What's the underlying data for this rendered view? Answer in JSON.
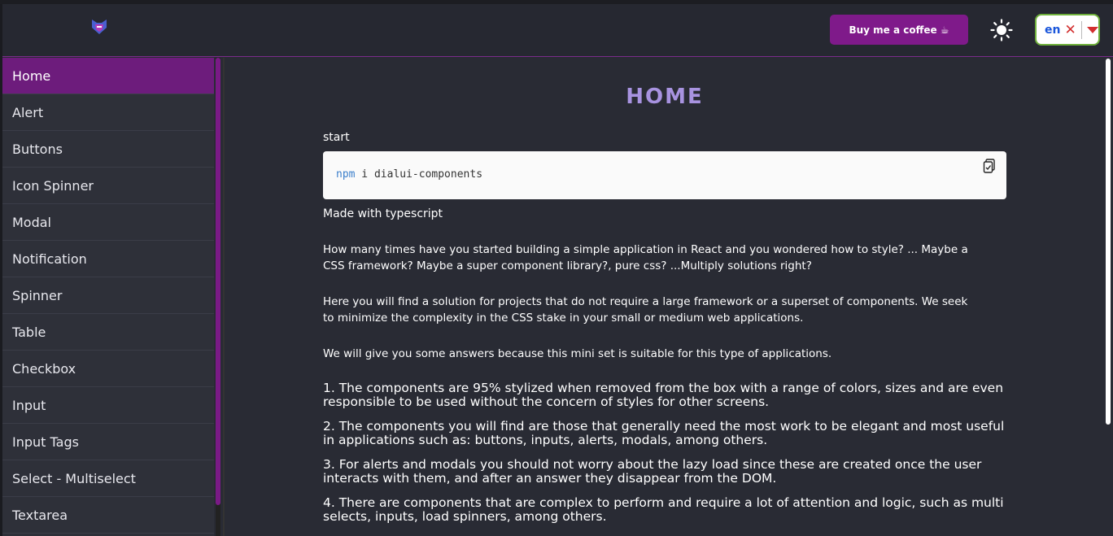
{
  "header": {
    "coffee_button": "Buy me a coffee ☕",
    "language": {
      "value": "en"
    }
  },
  "sidebar": {
    "items": [
      {
        "label": "Home",
        "active": true
      },
      {
        "label": "Alert"
      },
      {
        "label": "Buttons"
      },
      {
        "label": "Icon Spinner"
      },
      {
        "label": "Modal"
      },
      {
        "label": "Notification"
      },
      {
        "label": "Spinner"
      },
      {
        "label": "Table"
      },
      {
        "label": "Checkbox"
      },
      {
        "label": "Input"
      },
      {
        "label": "Input Tags"
      },
      {
        "label": "Select - Multiselect"
      },
      {
        "label": "Textarea"
      }
    ]
  },
  "main": {
    "title": "HOME",
    "start_label": "start",
    "code": {
      "keyword": "npm",
      "rest": " i dialui-components"
    },
    "made_with": "Made with typescript",
    "paragraphs": [
      "How many times have you started building a simple application in React and you wondered how to style? ... Maybe a CSS framework? Maybe a super component library?, pure css? ...Multiply solutions right?",
      "Here you will find a solution for projects that do not require a large framework or a superset of components. We seek to minimize the complexity in the CSS stake in your small or medium web applications.",
      "We will give you some answers because this mini set is suitable for this type of applications."
    ],
    "list": [
      "1. The components are 95% stylized when removed from the box with a range of colors, sizes and are even responsible to be used without the concern of styles for other screens.",
      "2. The components you will find are those that generally need the most work to be elegant and most useful in applications such as: buttons, inputs, alerts, modals, among others.",
      "3. For alerts and modals you should not worry about the lazy load since these are created once the user interacts with them, and after an answer they disappear from the DOM.",
      "4. There are components that are complex to perform and require a lot of attention and logic, such as multi selects, inputs, load spinners, among others."
    ]
  },
  "colors": {
    "accent": "#6d1c7c",
    "title": "#a893e0",
    "background": "#292b34",
    "sidebar": "#2e3039"
  },
  "icons": {
    "logo": "fox-logo",
    "theme": "sun-icon",
    "copy": "clipboard-icon"
  }
}
